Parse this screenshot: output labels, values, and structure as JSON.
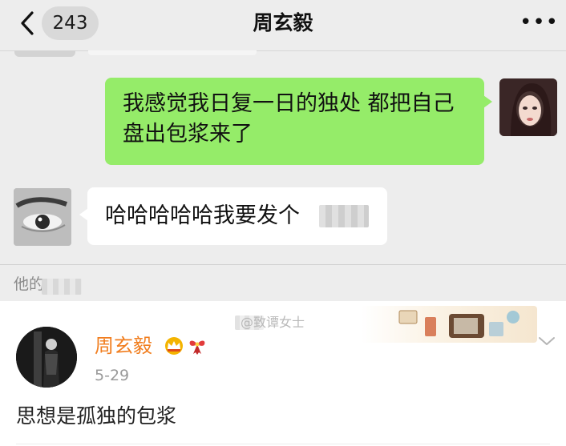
{
  "chat": {
    "back_count": "243",
    "title": "周玄毅",
    "more_label": "•••",
    "messages": [
      {
        "side": "right",
        "text": "我感觉我日复一日的独处 都把自己盘出包浆来了"
      },
      {
        "side": "left",
        "text": "哈哈哈哈哈我要发个"
      }
    ],
    "bottom_caption": "他的"
  },
  "post": {
    "watermark": "@致谭女士",
    "username": "周玄毅",
    "date": "5-29",
    "text": "思想是孤独的包浆"
  },
  "colors": {
    "bubble_green": "#95ec69",
    "chat_bg": "#ededed",
    "username_orange": "#f17e1f"
  },
  "icons": [
    "back-chevron-icon",
    "more-icon",
    "crown-icon",
    "ribbon-icon",
    "chevron-down-icon"
  ]
}
